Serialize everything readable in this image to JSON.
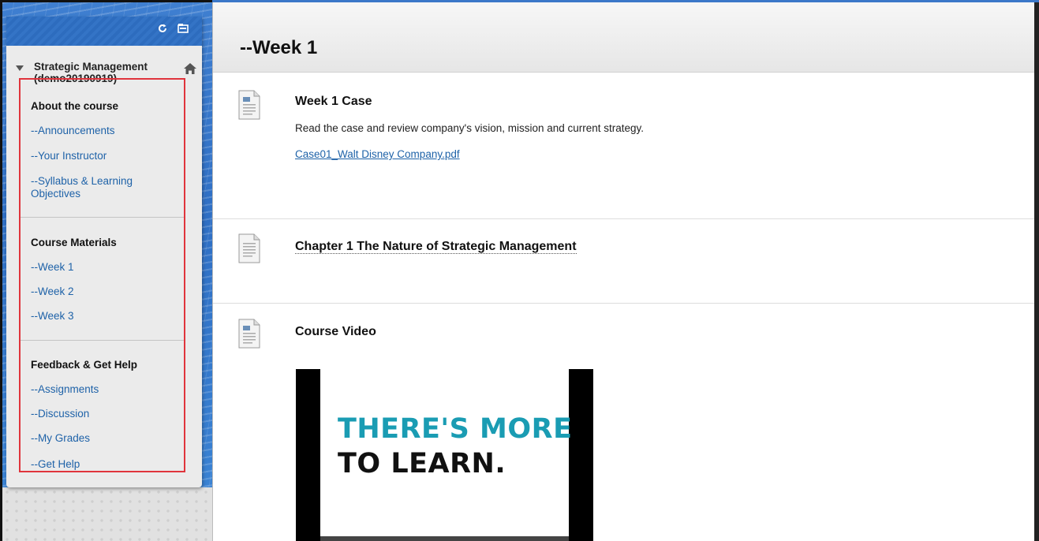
{
  "sidebar": {
    "course_title": "Strategic Management (demo20190919)",
    "tools": {
      "refresh_icon": "refresh-icon",
      "folder_icon": "folder-icon",
      "home_icon": "home-icon"
    },
    "sections": [
      {
        "heading": "About the course",
        "items": [
          "--Announcements",
          "--Your Instructor",
          "--Syllabus & Learning Objectives"
        ]
      },
      {
        "heading": "Course Materials",
        "items": [
          "--Week 1",
          "--Week 2",
          "--Week 3"
        ]
      },
      {
        "heading": "Feedback & Get Help",
        "items": [
          "--Assignments",
          "--Discussion",
          "--My Grades",
          "--Get Help"
        ]
      }
    ],
    "highlight_color": "#e0343c"
  },
  "main": {
    "page_title": "--Week 1",
    "items": [
      {
        "title": "Week 1 Case",
        "description": "Read the case and review company's vision, mission and current strategy.",
        "attachment": "Case01_Walt Disney Company.pdf"
      },
      {
        "title": "Chapter 1 The Nature of Strategic Management"
      },
      {
        "title": "Course Video",
        "video": {
          "line1": "THERE'S MORE",
          "line2": "TO LEARN."
        }
      }
    ]
  }
}
